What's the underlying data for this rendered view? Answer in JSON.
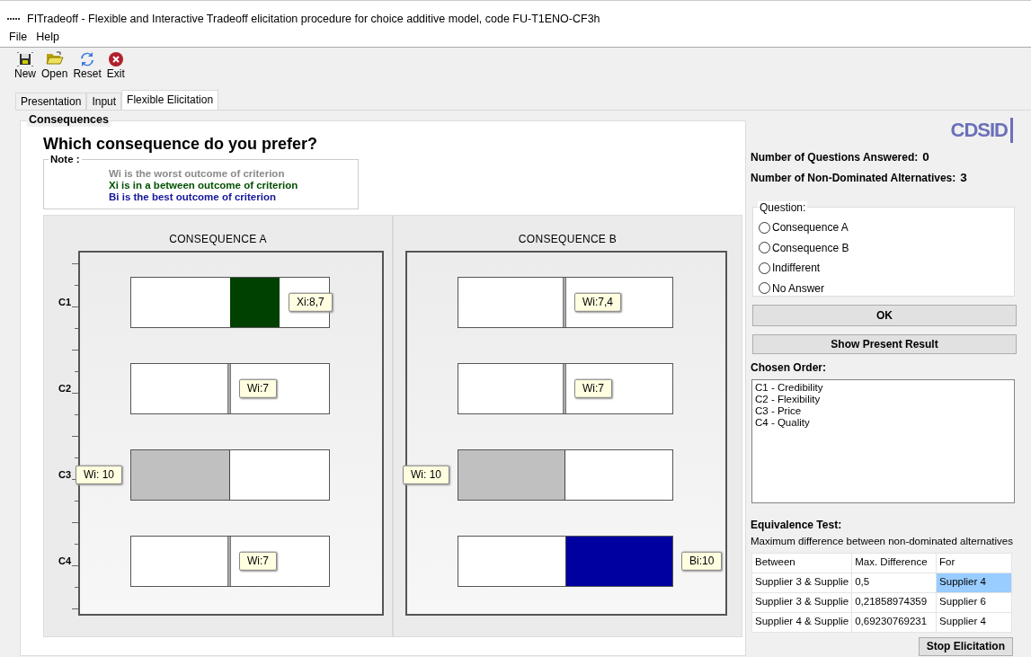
{
  "window": {
    "title": "FITradeoff - Flexible and Interactive Tradeoff elicitation  procedure for choice additive model, code FU-T1ENO-CF3h"
  },
  "menu": [
    "File",
    "Help"
  ],
  "toolbar": [
    {
      "label": "New",
      "kind": "new"
    },
    {
      "label": "Open",
      "kind": "open"
    },
    {
      "label": "Reset",
      "kind": "reset"
    },
    {
      "label": "Exit",
      "kind": "exit"
    }
  ],
  "tabs": [
    {
      "label": "Presentation",
      "selected": false
    },
    {
      "label": "Input",
      "selected": false
    },
    {
      "label": "Flexible Elicitation",
      "selected": true
    }
  ],
  "consequences": {
    "title": "Consequences",
    "question": "Which consequence do you prefer?",
    "note": {
      "title": "Note :",
      "lines": [
        {
          "text": "Wi is the worst outcome of criterion",
          "kind": "worst"
        },
        {
          "text": "Xi is in a between outcome of criterion",
          "kind": "between"
        },
        {
          "text": "Bi is the best outcome of criterion",
          "kind": "best"
        }
      ]
    },
    "criteria": [
      "C1",
      "C2",
      "C3",
      "C4"
    ],
    "panels": [
      {
        "title": "CONSEQUENCE A",
        "bars": [
          {
            "kind": "between",
            "tag": "Xi:8,7"
          },
          {
            "kind": "line",
            "tag": "Wi:7"
          },
          {
            "kind": "worst",
            "level": 0.5,
            "tag": "Wi: 10"
          },
          {
            "kind": "line",
            "tag": "Wi:7"
          }
        ]
      },
      {
        "title": "CONSEQUENCE B",
        "bars": [
          {
            "kind": "line",
            "tag": "Wi:7,4"
          },
          {
            "kind": "line",
            "tag": "Wi:7"
          },
          {
            "kind": "worst",
            "level": 0.5,
            "tag": "Wi: 10"
          },
          {
            "kind": "best",
            "tag": "Bi:10"
          }
        ]
      }
    ]
  },
  "side": {
    "logo": "CDSID",
    "stats": [
      {
        "label": "Number of Questions Answered:",
        "value": "0"
      },
      {
        "label": "Number of Non-Dominated Alternatives:",
        "value": "3"
      }
    ],
    "question": {
      "title": "Question:",
      "options": [
        {
          "label": "Consequence A",
          "selected": false
        },
        {
          "label": "Consequence B",
          "selected": false
        },
        {
          "label": "Indifferent",
          "selected": false
        },
        {
          "label": "No Answer",
          "selected": false
        }
      ]
    },
    "ok_button": "OK",
    "result_button": "Show Present Result",
    "order_title": "Chosen Order:",
    "order": [
      "C1 - Credibility",
      "C2 - Flexibility",
      "C3 - Price",
      "C4 - Quality"
    ],
    "equivalence_title": "Equivalence Test:",
    "equivalence_note": "Maximum difference between non-dominated alternatives",
    "table": {
      "columns": [
        "Between",
        "Max. Difference",
        "For"
      ],
      "rows": [
        {
          "between": "Supplier 3 & Supplie",
          "difference": "0,5",
          "for": "Supplier 4",
          "selected": true
        },
        {
          "between": "Supplier 3 & Supplie",
          "difference": "0,21858974359",
          "for": "Supplier 6",
          "selected": false
        },
        {
          "between": "Supplier 4 & Supplie",
          "difference": "0,69230769231",
          "for": "Supplier 4",
          "selected": false
        }
      ]
    },
    "stop_button": "Stop Elicitation"
  }
}
